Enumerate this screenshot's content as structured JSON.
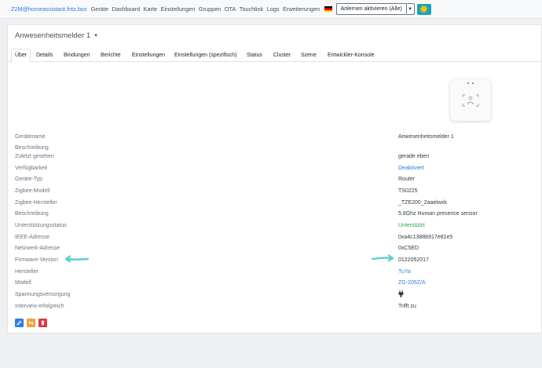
{
  "navbar": {
    "brand": "Z2M@homeassistant.fritz.box",
    "links": [
      "Geräte",
      "Dashboard",
      "Karte",
      "Einstellungen",
      "Gruppen",
      "OTA",
      "Touchlink",
      "Logs",
      "Erweiterungen"
    ],
    "permit_join": "Anlernen aktivieren (Alle)"
  },
  "device": {
    "title": "Anwesenheitsmelder 1"
  },
  "tabs": [
    "Über",
    "Details",
    "Bindungen",
    "Berichte",
    "Einstellungen",
    "Einstellungen (spezifisch)",
    "Status",
    "Cluster",
    "Szene",
    "Entwickler-Konsole"
  ],
  "properties": [
    {
      "label": "Gerätename",
      "value": "Anwesenheitsmelder 1"
    },
    {
      "label": "Beschreibung",
      "value": ""
    },
    {
      "label": "Zuletzt gesehen",
      "value": "gerade eben"
    },
    {
      "label": "Verfügbarkeit",
      "value": "Deaktiviert"
    },
    {
      "label": "Geräte-Typ",
      "value": "Router"
    },
    {
      "label": "Zigbee-Modell",
      "value": "TS0225"
    },
    {
      "label": "Zigbee-Hersteller",
      "value": "_TZE200_2aaelwxk"
    },
    {
      "label": "Beschreibung",
      "value": "5.8Ghz Human presence sensor"
    },
    {
      "label": "Unterstützungsstatus",
      "value": "Unterstützt"
    },
    {
      "label": "IEEE-Adresse",
      "value": "0xa4c1388b917e81e5"
    },
    {
      "label": "Netzwerk-Adresse",
      "value": "0xC5ED"
    },
    {
      "label": "Firmware-Version",
      "value": "0122052017"
    },
    {
      "label": "Hersteller",
      "value": "TuYa"
    },
    {
      "label": "Modell",
      "value": "ZG-205Z/A"
    },
    {
      "label": "Spannungsversorgung",
      "value": ""
    },
    {
      "label": "Interview erfolgreich",
      "value": "Trifft zu"
    }
  ],
  "colors": {
    "link": "#2c7be5",
    "success": "#28a745",
    "rename_button": "#2c7be5",
    "reconfigure_button": "#f0a33a",
    "remove_button": "#dc3545",
    "arrow": "#5fd0d0"
  }
}
